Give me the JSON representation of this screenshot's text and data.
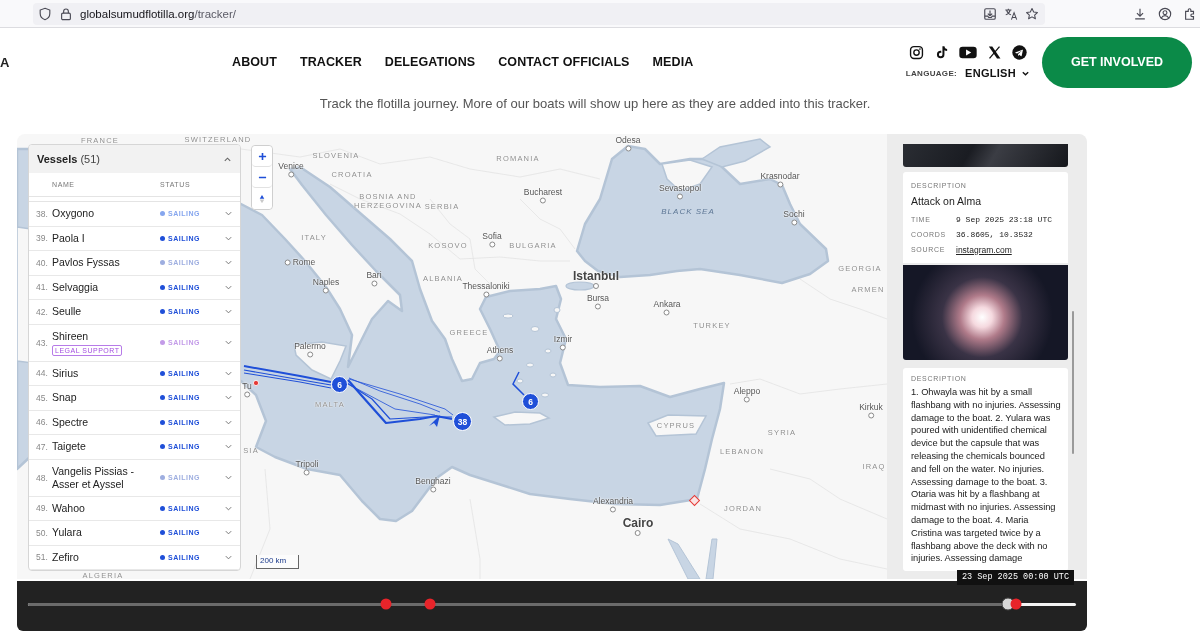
{
  "browser": {
    "url_host": "globalsumudflotilla.org",
    "url_path": "/tracker/"
  },
  "header": {
    "logo_fragment": "A",
    "nav": [
      "ABOUT",
      "TRACKER",
      "DELEGATIONS",
      "CONTACT OFFICIALS",
      "MEDIA"
    ],
    "language_label": "LANGUAGE:",
    "language": "ENGLISH",
    "cta": "GET INVOLVED"
  },
  "intro": "Track the flotilla journey. More of our boats will show up here as they are added into this tracker.",
  "vessels": {
    "title": "Vessels",
    "count": "(51)",
    "expanded": true,
    "columns": [
      "NAME",
      "STATUS"
    ],
    "rows": [
      {
        "number": "38.",
        "name": "Oxygono",
        "status": "SAILING",
        "color": "#86a6ee",
        "expanded": false
      },
      {
        "number": "39.",
        "name": "Paola I",
        "status": "SAILING",
        "color": "#1f4fd8",
        "expanded": false
      },
      {
        "number": "40.",
        "name": "Pavlos Fyssas",
        "status": "SAILING",
        "color": "#9eaee0",
        "expanded": false
      },
      {
        "number": "41.",
        "name": "Selvaggia",
        "status": "SAILING",
        "color": "#1f4fd8",
        "expanded": false
      },
      {
        "number": "42.",
        "name": "Seulle",
        "status": "SAILING",
        "color": "#1f4fd8",
        "expanded": false
      },
      {
        "number": "43.",
        "name": "Shireen",
        "badge": "LEGAL SUPPORT",
        "status": "SAILING",
        "color": "#c39be8",
        "expanded": false
      },
      {
        "number": "44.",
        "name": "Sirius",
        "status": "SAILING",
        "color": "#1f4fd8",
        "expanded": false
      },
      {
        "number": "45.",
        "name": "Snap",
        "status": "SAILING",
        "color": "#1f4fd8",
        "expanded": false
      },
      {
        "number": "46.",
        "name": "Spectre",
        "status": "SAILING",
        "color": "#1f4fd8",
        "expanded": false
      },
      {
        "number": "47.",
        "name": "Taigete",
        "status": "SAILING",
        "color": "#1f4fd8",
        "expanded": false
      },
      {
        "number": "48.",
        "name": "Vangelis Pissias - Asser et Ayssel",
        "status": "SAILING",
        "color": "#9eaee0",
        "expanded": false
      },
      {
        "number": "49.",
        "name": "Wahoo",
        "status": "SAILING",
        "color": "#1f4fd8",
        "expanded": false
      },
      {
        "number": "50.",
        "name": "Yulara",
        "status": "SAILING",
        "color": "#1f4fd8",
        "expanded": false
      },
      {
        "number": "51.",
        "name": "Zefiro",
        "status": "SAILING",
        "color": "#1f4fd8",
        "expanded": false
      }
    ]
  },
  "map": {
    "labels": [
      {
        "text": "FRANCE",
        "kind": "country"
      },
      {
        "text": "SWITZERLAND",
        "kind": "country"
      },
      {
        "text": "SLOVENIA",
        "kind": "country"
      },
      {
        "text": "Odesa",
        "kind": "city"
      },
      {
        "text": "Venice",
        "kind": "city"
      },
      {
        "text": "ROMANIA",
        "kind": "country"
      },
      {
        "text": "CROATIA",
        "kind": "country"
      },
      {
        "text": "Krasnodar",
        "kind": "city"
      },
      {
        "text": "Sevastopol",
        "kind": "city"
      },
      {
        "text": "Bucharest",
        "kind": "city"
      },
      {
        "text": "BOSNIA AND HERZEGOVINA",
        "kind": "country"
      },
      {
        "text": "SERBIA",
        "kind": "country"
      },
      {
        "text": "BLACK SEA",
        "kind": "sea"
      },
      {
        "text": "Sochi",
        "kind": "city"
      },
      {
        "text": "Sofia",
        "kind": "city"
      },
      {
        "text": "ITALY",
        "kind": "country"
      },
      {
        "text": "KOSOVO",
        "kind": "country"
      },
      {
        "text": "BULGARIA",
        "kind": "country"
      },
      {
        "text": "Rome",
        "kind": "city"
      },
      {
        "text": "GEORGIA",
        "kind": "country"
      },
      {
        "text": "Bari",
        "kind": "city"
      },
      {
        "text": "Istanbul",
        "kind": "major_city"
      },
      {
        "text": "Naples",
        "kind": "city"
      },
      {
        "text": "ALBANIA",
        "kind": "country"
      },
      {
        "text": "Thessaloniki",
        "kind": "city"
      },
      {
        "text": "ARMEN",
        "kind": "country"
      },
      {
        "text": "Bursa",
        "kind": "city"
      },
      {
        "text": "Ankara",
        "kind": "city"
      },
      {
        "text": "TURKEY",
        "kind": "country"
      },
      {
        "text": "GREECE",
        "kind": "country"
      },
      {
        "text": "Izmir",
        "kind": "city"
      },
      {
        "text": "Palermo",
        "kind": "city"
      },
      {
        "text": "Athens",
        "kind": "city"
      },
      {
        "text": "Tu",
        "kind": "city"
      },
      {
        "text": "Aleppo",
        "kind": "city"
      },
      {
        "text": "MALTA",
        "kind": "country"
      },
      {
        "text": "Kirkuk",
        "kind": "city"
      },
      {
        "text": "CYPRUS",
        "kind": "country"
      },
      {
        "text": "SYRIA",
        "kind": "country"
      },
      {
        "text": "LEBANON",
        "kind": "country"
      },
      {
        "text": "SIA",
        "kind": "country"
      },
      {
        "text": "Tripoli",
        "kind": "city"
      },
      {
        "text": "IRAQ",
        "kind": "country"
      },
      {
        "text": "Benghazi",
        "kind": "city"
      },
      {
        "text": "Alexandria",
        "kind": "city"
      },
      {
        "text": "JORDAN",
        "kind": "country"
      },
      {
        "text": "Cairo",
        "kind": "major_city"
      },
      {
        "text": "ALGERIA",
        "kind": "country"
      }
    ],
    "clusters": [
      "6",
      "38",
      "6"
    ],
    "scale": "200 km"
  },
  "event_feed": {
    "items": [
      {
        "kind": "photo"
      },
      {
        "kind": "details",
        "label": "DESCRIPTION",
        "title": "Attack on Alma",
        "fields": [
          {
            "label": "TIME",
            "value": "9 Sep 2025 23:18 UTC",
            "kind": "text"
          },
          {
            "label": "COORDS",
            "value": "36.8605, 10.3532",
            "kind": "text"
          },
          {
            "label": "SOURCE",
            "value": "instagram.com",
            "kind": "link"
          }
        ]
      },
      {
        "kind": "photo"
      },
      {
        "kind": "note",
        "label": "DESCRIPTION",
        "body": "1. Ohwayla was hit by a small flashbang with no injuries. Assessing damage to the boat. 2. Yulara was poured with unidentified chemical device but the capsule that was releasing the chemicals bounced and fell on the water. No injuries. Assessing damage to the boat. 3. Otaria was hit by a flashbang at midmast with no injuries. Assessing damage to the boat. 4. Maria Cristina was targeted twice by a flashbang above the deck with no injuries. Assessing damage"
      }
    ]
  },
  "timeline": {
    "level": 0.935,
    "date": "23 Sep 2025 00:00 UTC"
  }
}
